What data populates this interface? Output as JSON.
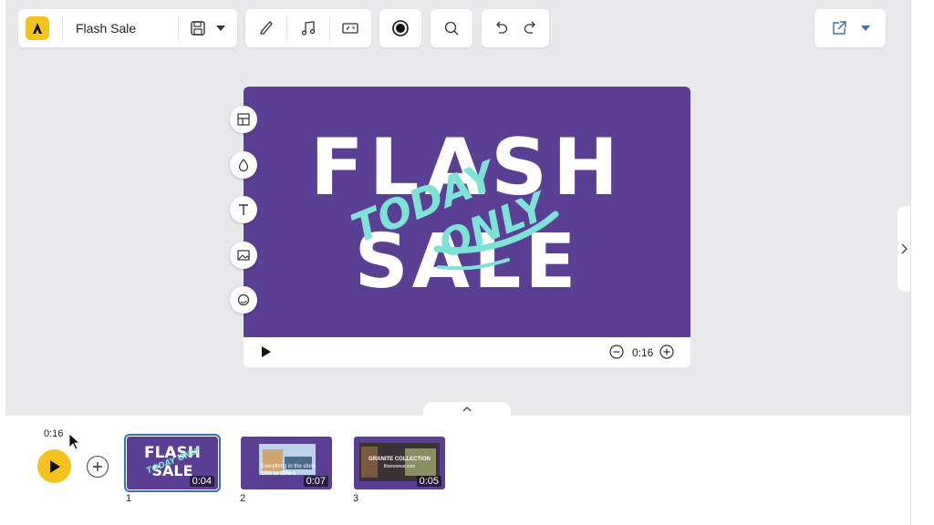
{
  "toolbar": {
    "project_title": "Flash Sale",
    "icons": [
      "logo-icon",
      "save-icon",
      "chevron-down-icon",
      "brush-icon",
      "music-icon",
      "resize-icon",
      "record-icon",
      "search-icon",
      "undo-icon",
      "redo-icon",
      "export-icon",
      "chevron-down-icon"
    ]
  },
  "canvas": {
    "headline_1": "FLASH",
    "headline_2": "SALE",
    "overlay_1": "TODAY",
    "overlay_2": "ONLY",
    "background_color": "#5b3f94",
    "overlay_color": "#7de3d4",
    "duration": "0:16"
  },
  "side_tools": [
    "layout-icon",
    "color-drop-icon",
    "text-icon",
    "image-icon",
    "sticker-icon"
  ],
  "timeline": {
    "current_time": "0:16",
    "scenes": [
      {
        "number": "1",
        "duration": "0:04",
        "title_1": "FLASH",
        "title_2": "SALE",
        "overlay": "TODAY ONLY"
      },
      {
        "number": "2",
        "duration": "0:07",
        "caption_1": "Everything in the store",
        "caption_2": "15% to 30% o"
      },
      {
        "number": "3",
        "duration": "0:05",
        "caption_1": "GRANITE COLLECTION",
        "caption_2": "fitnewwear.com"
      }
    ]
  },
  "colors": {
    "accent_yellow": "#f6c31c",
    "selection_blue": "#3b6fb6",
    "workspace_bg": "#e9e8ea"
  }
}
